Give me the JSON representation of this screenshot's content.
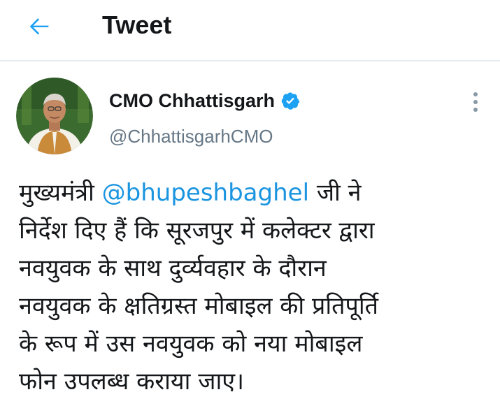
{
  "header": {
    "title": "Tweet",
    "back_icon": "arrow-left-icon",
    "accent": "#1da1f2"
  },
  "tweet": {
    "author": {
      "name": "CMO Chhattisgarh",
      "handle": "@ChhattisgarhCMO",
      "verified_icon": "verified-badge-icon"
    },
    "more_icon": "vertical-dots-icon",
    "text": {
      "line1_before": "मुख्यमंत्री ",
      "mention": "@bhupeshbaghel",
      "line1_after": " जी ने",
      "line2": "निर्देश दिए हैं कि सूरजपुर में कलेक्टर द्वारा",
      "line3": "नवयुवक के साथ दुर्व्यवहार के दौरान",
      "line4": "नवयुवक के क्षतिग्रस्त मोबाइल की प्रतिपूर्ति",
      "line5": "के रूप में उस नवयुवक को नया मोबाइल",
      "line6": "फोन उपलब्ध कराया जाए।"
    }
  },
  "colors": {
    "text": "#14171a",
    "secondary": "#657786",
    "link": "#1b95e0",
    "divider": "#e6ecf0"
  }
}
